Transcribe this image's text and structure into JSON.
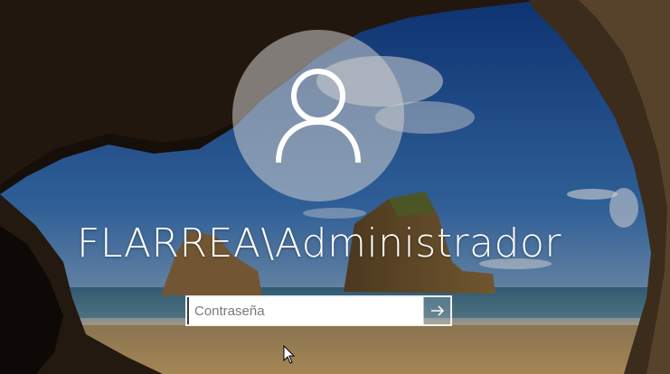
{
  "login": {
    "username": "FLARREA\\Administrador",
    "password_placeholder": "Contraseña",
    "password_value": ""
  },
  "icons": {
    "avatar": "user-silhouette-icon",
    "submit": "arrow-right-icon",
    "cursor": "mouse-pointer-icon"
  },
  "colors": {
    "text": "#ffffff",
    "avatar_bg": "#cdcdcd",
    "input_bg": "#ffffff"
  }
}
